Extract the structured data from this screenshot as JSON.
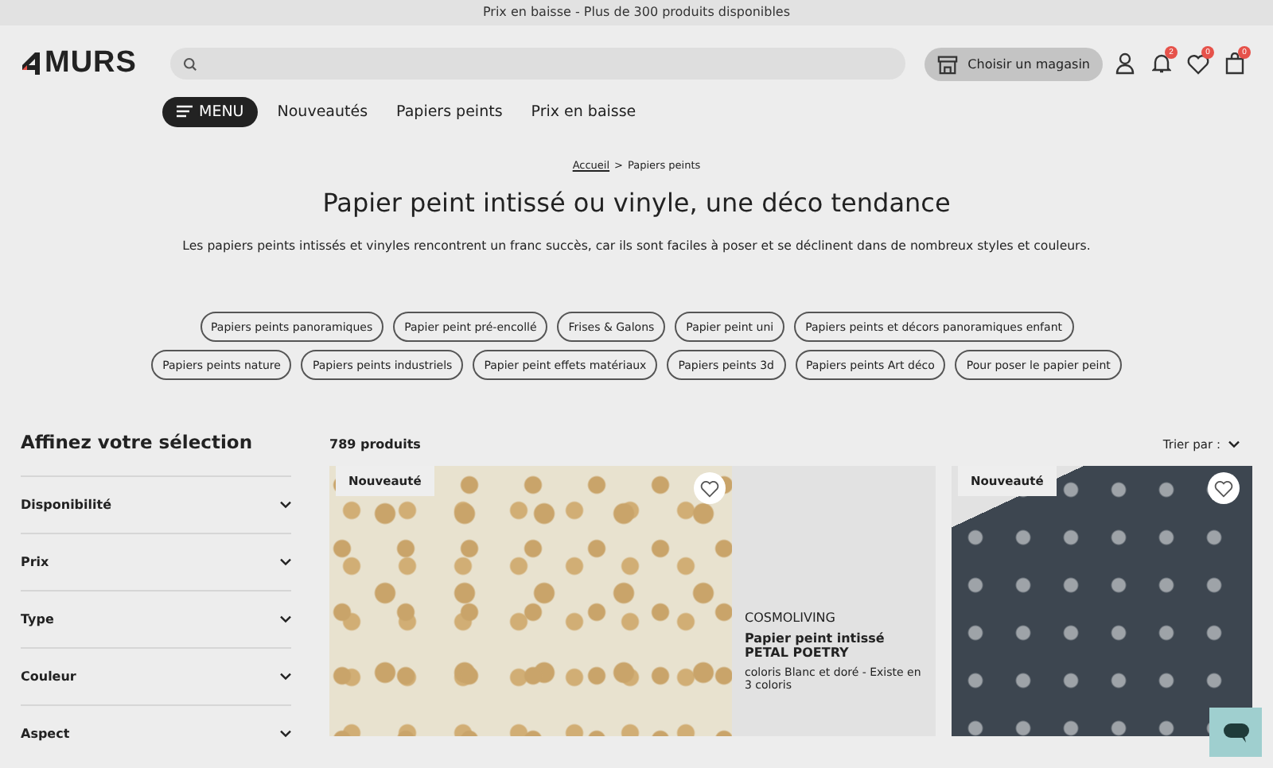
{
  "banner": {
    "text": "Prix en baisse - Plus de 300 produits disponibles"
  },
  "header": {
    "logo": "MURS",
    "store_button": "Choisir un magasin",
    "icons": [
      {
        "kind": "user"
      },
      {
        "kind": "bell",
        "badge": "2"
      },
      {
        "kind": "heart",
        "badge": "0"
      },
      {
        "kind": "bag",
        "badge": "0"
      }
    ]
  },
  "nav": {
    "menu_button": "MENU",
    "links": [
      "Nouveautés",
      "Papiers peints",
      "Prix en baisse"
    ]
  },
  "breadcrumb": {
    "items": [
      "Accueil",
      "Papiers peints"
    ],
    "separator": ">"
  },
  "title": "Papier peint intissé ou vinyle, une déco tendance",
  "description": "Les papiers peints intissés et vinyles rencontrent un franc succès, car ils sont faciles à poser et se déclinent dans de nombreux styles et couleurs.",
  "chip_rows": [
    [
      "Papiers peints panoramiques",
      "Papier peint pré-encollé",
      "Frises & Galons",
      "Papier peint uni",
      "Papiers peints et décors panoramiques enfant"
    ],
    [
      "Papiers peints nature",
      "Papiers peints industriels",
      "Papier peint effets matériaux",
      "Papiers peints 3d",
      "Papiers peints Art déco",
      "Pour poser le papier peint"
    ]
  ],
  "filters": {
    "title": "Affinez votre sélection",
    "items": [
      "Disponibilité",
      "Prix",
      "Type",
      "Couleur",
      "Aspect"
    ]
  },
  "results": {
    "count": "789 produits",
    "sort_label": "Trier par :"
  },
  "products": [
    {
      "kind": "detail",
      "badge": "Nouveauté",
      "brand": "COSMOLIVING",
      "name": "Papier peint intissé",
      "model": "PETAL POETRY",
      "info": "coloris Blanc et doré - Existe en 3 coloris"
    },
    {
      "kind": "image",
      "badge": "Nouveauté"
    }
  ]
}
